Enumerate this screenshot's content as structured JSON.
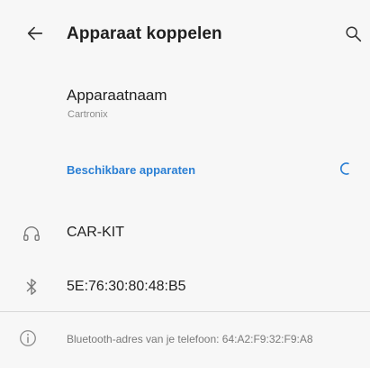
{
  "appbar": {
    "title": "Apparaat koppelen",
    "back_icon": "arrow-left-icon",
    "search_icon": "search-icon"
  },
  "device_name": {
    "label": "Apparaatnaam",
    "value": "Cartronix"
  },
  "available": {
    "title": "Beschikbare apparaten",
    "spinner_icon": "loading-spinner-icon",
    "accent_color": "#2a7fd4",
    "devices": [
      {
        "icon": "headphones-icon",
        "label": "CAR-KIT"
      },
      {
        "icon": "bluetooth-icon",
        "label": "5E:76:30:80:48:B5"
      }
    ]
  },
  "footer": {
    "icon": "info-icon",
    "text": "Bluetooth-adres van je telefoon: 64:A2:F9:32:F9:A8"
  }
}
